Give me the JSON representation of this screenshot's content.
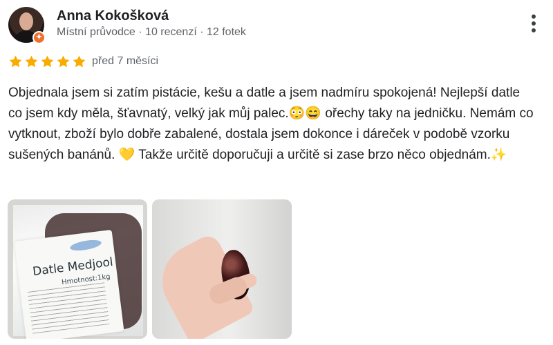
{
  "reviewer": {
    "name": "Anna Kokošková",
    "meta": "Místní průvodce · 10 recenzí · 12 fotek"
  },
  "review": {
    "rating": 5,
    "max_rating": 5,
    "date": "před 7 měsíci",
    "text": "Objednala jsem si zatím pistácie, kešu a datle a jsem nadmíru spokojená! Nejlepší datle co jsem kdy měla, šťavnatý, velký jak můj palec.😳😄 ořechy taky na jedničku. Nemám co vytknout, zboží bylo dobře zabalené, dostala jsem dokonce i dáreček v podobě vzorku sušených banánů. 💛 Takže určitě doporučuji a určitě si zase brzo něco objednám.✨"
  },
  "photos": [
    {
      "label_title": "Datle Medjool",
      "label_weight": "Hmotnost:1kg"
    },
    {}
  ],
  "icons": {
    "star": "star-icon",
    "more": "more-vert-icon",
    "badge": "local-guide-badge"
  },
  "colors": {
    "star": "#f9ab00",
    "local_guide_badge": "#f06f2a",
    "secondary_text": "#5f6368"
  }
}
